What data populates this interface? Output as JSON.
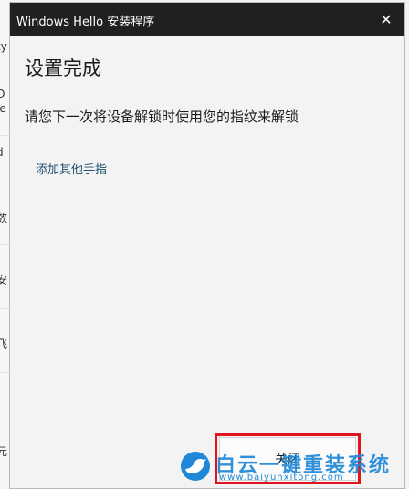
{
  "background": {
    "fragments": [
      "ty",
      "O",
      "ie",
      "d",
      "数",
      "安",
      "飞",
      "元"
    ]
  },
  "dialog": {
    "title": "Windows Hello 安装程序",
    "close_icon": "✕",
    "heading": "设置完成",
    "description": "请您下一次将设备解锁时使用您的指纹来解锁",
    "add_link": "添加其他手指",
    "close_button": "关闭"
  },
  "watermark": {
    "text": "白云一键重装系统",
    "url": "www.baiyunxitong.com"
  },
  "colors": {
    "titlebar": "#202020",
    "highlight": "#e0141e",
    "link": "#1f4e6e",
    "watermark": "#1f87d6"
  }
}
